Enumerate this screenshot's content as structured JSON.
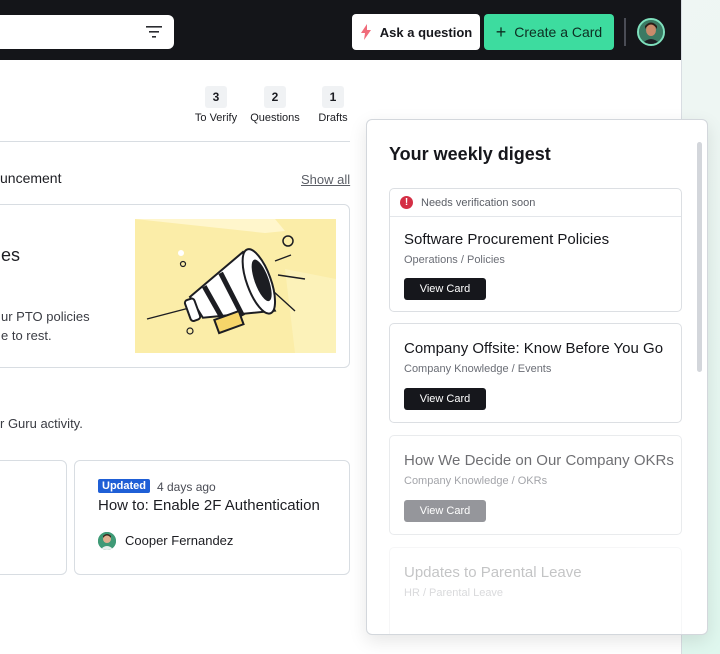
{
  "topbar": {
    "ask_label": "Ask a question",
    "create_label": "Create a Card"
  },
  "stats": [
    {
      "count": "3",
      "label": "To Verify"
    },
    {
      "count": "2",
      "label": "Questions"
    },
    {
      "count": "1",
      "label": "Drafts"
    }
  ],
  "announcements": {
    "section_title": "uncement",
    "show_all": "Show all",
    "card": {
      "title_fragment": "es",
      "line1": "ur PTO policies",
      "line2": "e to rest."
    }
  },
  "activity": {
    "subtitle": "r Guru activity.",
    "card": {
      "badge": "Updated",
      "time": "4 days ago",
      "title": "How to: Enable 2F Authentication",
      "author": "Cooper Fernandez"
    }
  },
  "digest": {
    "title": "Your weekly digest",
    "cards": [
      {
        "alert": "Needs verification soon",
        "title": "Software Procurement Policies",
        "path": "Operations / Policies",
        "button": "View Card"
      },
      {
        "title": "Company Offsite: Know Before You Go",
        "path": "Company Knowledge / Events",
        "button": "View Card"
      },
      {
        "title": "How We Decide on Our Company OKRs",
        "path": "Company Knowledge / OKRs",
        "button": "View Card"
      },
      {
        "title": "Updates to Parental Leave",
        "path": "HR / Parental Leave"
      }
    ]
  },
  "colors": {
    "topbar": "#141519",
    "accent_green": "#3ddc9f",
    "updated_badge": "#1f5fd6",
    "alert_red": "#d42f45",
    "illustration_bg": "#fbeda8"
  }
}
